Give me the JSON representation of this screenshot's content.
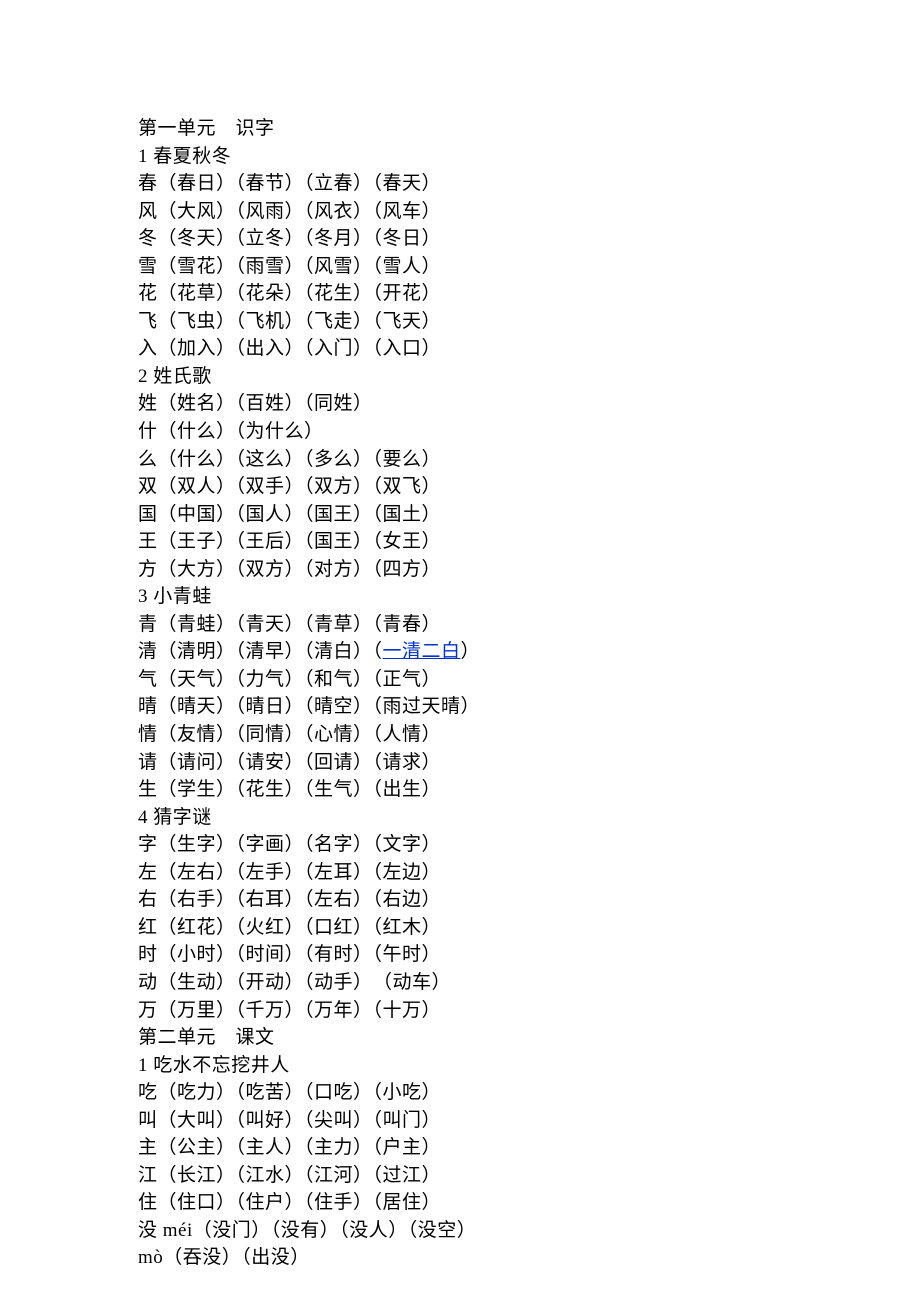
{
  "units": [
    {
      "title": "第一单元　识字",
      "lessons": [
        {
          "title": "1 春夏秋冬",
          "entries": [
            {
              "char": "春",
              "words": [
                "春日",
                "春节",
                "立春",
                "春天"
              ]
            },
            {
              "char": "风",
              "words": [
                "大风",
                "风雨",
                "风衣",
                "风车"
              ]
            },
            {
              "char": "冬",
              "words": [
                "冬天",
                "立冬",
                "冬月",
                "冬日"
              ]
            },
            {
              "char": "雪",
              "words": [
                "雪花",
                "雨雪",
                "风雪",
                "雪人"
              ]
            },
            {
              "char": "花",
              "words": [
                "花草",
                "花朵",
                "花生",
                "开花"
              ]
            },
            {
              "char": "飞",
              "words": [
                "飞虫",
                "飞机",
                "飞走",
                "飞天"
              ]
            },
            {
              "char": "入",
              "words": [
                "加入",
                "出入",
                "入门",
                "入口"
              ]
            }
          ]
        },
        {
          "title": "2 姓氏歌",
          "entries": [
            {
              "char": "姓",
              "words": [
                "姓名",
                "百姓",
                "同姓"
              ]
            },
            {
              "char": "什",
              "words": [
                "什么",
                "为什么"
              ]
            },
            {
              "char": "么",
              "words": [
                "什么",
                "这么",
                "多么",
                "要么"
              ]
            },
            {
              "char": "双",
              "words": [
                "双人",
                "双手",
                "双方",
                "双飞"
              ]
            },
            {
              "char": "国",
              "words": [
                "中国",
                "国人",
                "国王",
                "国土"
              ]
            },
            {
              "char": "王",
              "words": [
                "王子",
                "王后",
                "国王",
                "女王"
              ]
            },
            {
              "char": "方",
              "words": [
                "大方",
                "双方",
                "对方",
                "四方"
              ]
            }
          ]
        },
        {
          "title": "3 小青蛙",
          "entries": [
            {
              "char": "青",
              "words": [
                "青蛙",
                "青天",
                "青草",
                "青春"
              ]
            },
            {
              "char": "清",
              "words": [
                "清明",
                "清早",
                "清白",
                "一清二白"
              ],
              "linkIndex": 3
            },
            {
              "char": "气",
              "words": [
                "天气",
                "力气",
                "和气",
                "正气"
              ]
            },
            {
              "char": "晴",
              "words": [
                "晴天",
                "晴日",
                "晴空",
                "雨过天晴"
              ]
            },
            {
              "char": "情",
              "words": [
                "友情",
                "同情",
                "心情",
                "人情"
              ]
            },
            {
              "char": "请",
              "words": [
                "请问",
                "请安",
                "回请",
                "请求"
              ]
            },
            {
              "char": "生",
              "words": [
                "学生",
                "花生",
                "生气",
                "出生"
              ]
            }
          ]
        },
        {
          "title": "4 猜字谜",
          "entries": [
            {
              "char": "字",
              "words": [
                "生字",
                "字画",
                "名字",
                "文字"
              ]
            },
            {
              "char": "左",
              "words": [
                "左右",
                "左手",
                "左耳",
                "左边"
              ]
            },
            {
              "char": "右",
              "words": [
                "右手",
                "右耳",
                "左右",
                "右边"
              ]
            },
            {
              "char": "红",
              "words": [
                "红花",
                "火红",
                "口红",
                "红木"
              ]
            },
            {
              "char": "时",
              "words": [
                "小时",
                "时间",
                "有时",
                "午时"
              ]
            },
            {
              "char": "动",
              "words": [
                "生动",
                "开动",
                "动手",
                "动车"
              ],
              "extraSpaceIndex": 3
            },
            {
              "char": "万",
              "words": [
                "万里",
                "千万",
                "万年",
                "十万"
              ]
            }
          ]
        }
      ]
    },
    {
      "title": "第二单元　课文",
      "lessons": [
        {
          "title": "1 吃水不忘挖井人",
          "entries": [
            {
              "char": "吃",
              "words": [
                "吃力",
                "吃苦",
                "口吃",
                "小吃"
              ]
            },
            {
              "char": "叫",
              "words": [
                "大叫",
                "叫好",
                "尖叫",
                "叫门"
              ]
            },
            {
              "char": "主",
              "words": [
                "公主",
                "主人",
                "主力",
                "户主"
              ]
            },
            {
              "char": "江",
              "words": [
                "长江",
                "江水",
                "江河",
                "过江"
              ]
            },
            {
              "char": "住",
              "words": [
                "住口",
                "住户",
                "住手",
                "居住"
              ]
            },
            {
              "char": "没",
              "pinyin": "méi",
              "words": [
                "没门",
                "没有",
                "没人",
                "没空"
              ]
            },
            {
              "pinyin": "mò",
              "words": [
                "吞没",
                "出没"
              ]
            }
          ]
        }
      ]
    }
  ]
}
